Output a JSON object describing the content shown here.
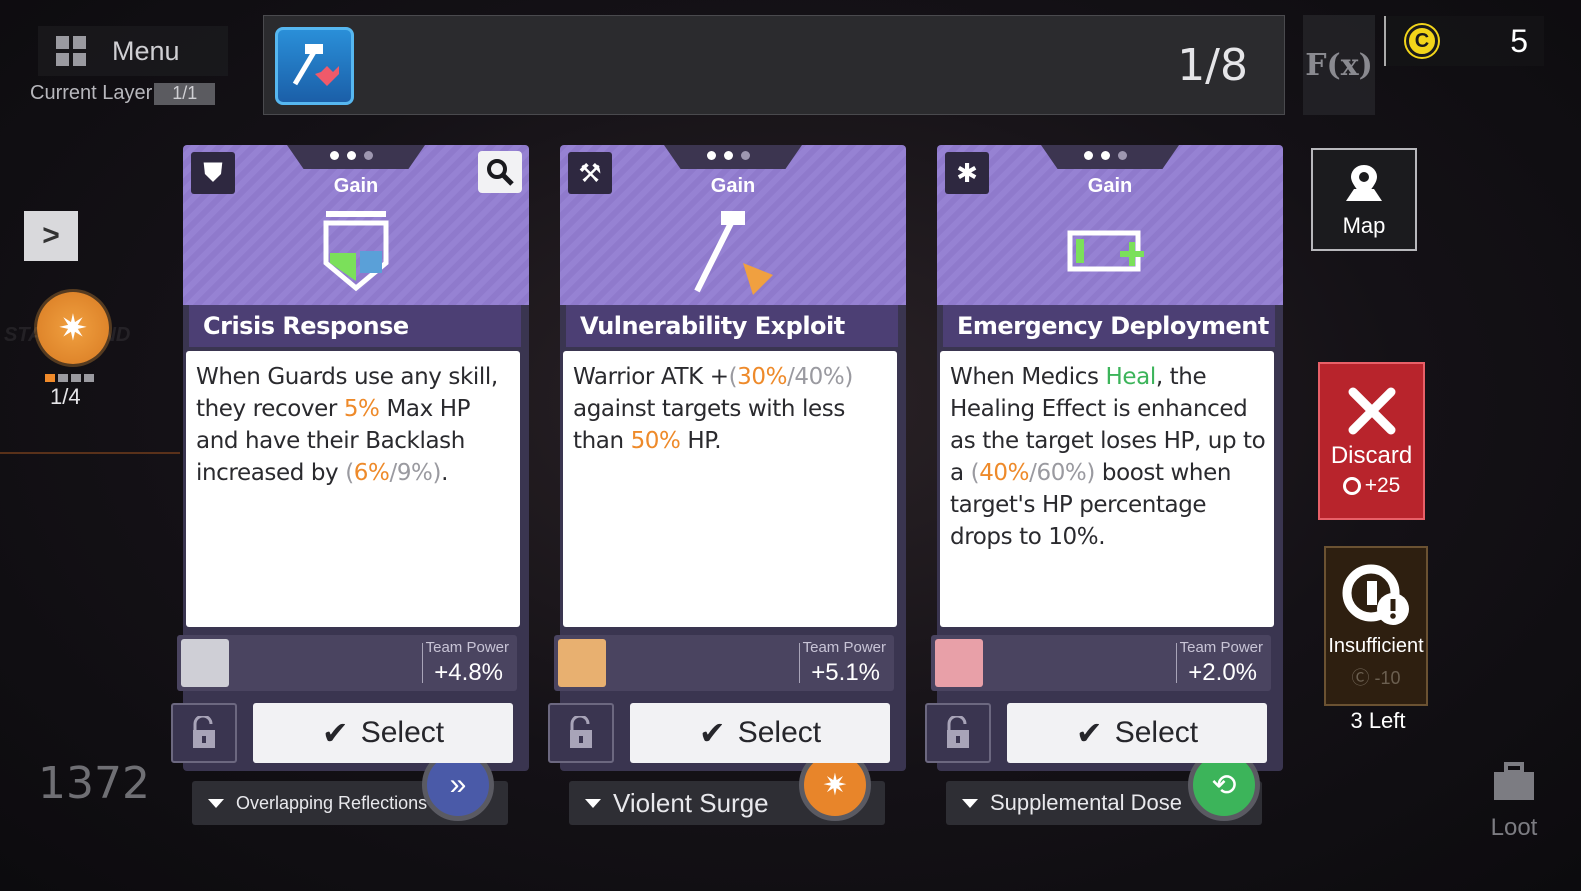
{
  "menu": {
    "label": "Menu"
  },
  "layer": {
    "label": "Current Layer",
    "value": "1/1"
  },
  "banner": {
    "progress": "1/8",
    "icon": "hammer-heart-icon"
  },
  "currency": {
    "amount": "5",
    "icon": "coin-icon"
  },
  "left_panel": {
    "node_level": "1/4",
    "big_number": "1372"
  },
  "cards": [
    {
      "type_icon": "shield-icon",
      "category": "Gain",
      "title": "Crisis Response",
      "description_html": "When Guards use any skill, they recover <span class=\"hl-orange\">5%</span> Max HP and have their Backlash increased by <span class=\"hl-gray\">(</span><span class=\"hl-orange\">6%</span><span class=\"hl-gray\">/9%)</span>.",
      "set_name": "Overlapping Reflections",
      "set_color": "#4a5aa8",
      "team_power_label": "Team Power",
      "team_power_value": "+4.8%",
      "select_label": "Select"
    },
    {
      "type_icon": "hammer-icon",
      "category": "Gain",
      "title": "Vulnerability Exploit",
      "description_html": "Warrior ATK +<span class=\"hl-gray\">(</span><span class=\"hl-orange\">30%</span><span class=\"hl-gray\">/40%)</span> against targets with less than <span class=\"hl-orange\">50%</span> HP.",
      "set_name": "Violent Surge",
      "set_color": "#e8852a",
      "team_power_label": "Team Power",
      "team_power_value": "+5.1%",
      "select_label": "Select"
    },
    {
      "type_icon": "snowflake-icon",
      "category": "Gain",
      "title": "Emergency Deployment",
      "description_html": "When Medics <span class=\"hl-green\">Heal</span>, the Healing Effect is enhanced as the target loses HP, up to a <span class=\"hl-gray\">(</span><span class=\"hl-orange\">40%</span><span class=\"hl-gray\">/60%)</span> boost when target's HP percentage drops to 10%.",
      "set_name": "Supplemental Dose",
      "set_color": "#3cb45a",
      "team_power_label": "Team Power",
      "team_power_value": "+2.0%",
      "select_label": "Select"
    }
  ],
  "side": {
    "map_label": "Map",
    "discard_label": "Discard",
    "discard_cost": "+25",
    "insufficient_label": "Insufficient",
    "insufficient_cost": "-10",
    "left_count": "3 Left",
    "loot_label": "Loot"
  }
}
